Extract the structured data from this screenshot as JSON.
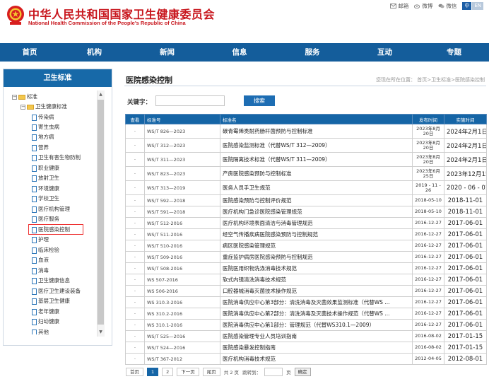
{
  "header": {
    "title": "中华人民共和国国家卫生健康委员会",
    "subtitle": "National Health Commission of the People's Republic of China",
    "links": [
      {
        "icon": "mail-icon",
        "label": "邮箱"
      },
      {
        "icon": "weibo-icon",
        "label": "微博"
      },
      {
        "icon": "wechat-icon",
        "label": "微信"
      }
    ],
    "lang_zh": "中",
    "lang_en": "EN"
  },
  "nav": [
    "首页",
    "机构",
    "新闻",
    "信息",
    "服务",
    "互动",
    "专题"
  ],
  "sidebar": {
    "title": "卫生标准",
    "root": "标准",
    "group": "卫生健康标准",
    "items": [
      "传染病",
      "寄生虫病",
      "地方病",
      "营养",
      "卫生有害生物防制",
      "职业健康",
      "放射卫生",
      "环境健康",
      "学校卫生",
      "医疗机构管理",
      "医疗服务",
      "医院感染控制",
      "护理",
      "临床检验",
      "血液",
      "消毒",
      "卫生健康信息",
      "医疗卫生建设装备",
      "基层卫生健康",
      "老年健康",
      "妇幼健康",
      "其他"
    ]
  },
  "main": {
    "title": "医院感染控制",
    "breadcrumb": "您现在所在位置： 首页>卫生标准>医院感染控制",
    "keyword_label": "关键字：",
    "keyword_value": "",
    "search_label": "搜索",
    "columns": [
      "查看",
      "标准号",
      "标准名",
      "发布时间",
      "实施时间"
    ],
    "rows": [
      {
        "view": "·",
        "std": "WS/T 826—2023",
        "name": "碳青霉烯类耐药肠杆菌预防与控制标准",
        "pub": "2023年8月20日",
        "impl": "2024年2月1日"
      },
      {
        "view": "·",
        "std": "WS/T 312—2023",
        "name": "医院感染监测标准（代替WS/T 312—2009）",
        "pub": "2023年8月20日",
        "impl": "2024年2月1日"
      },
      {
        "view": "·",
        "std": "WS/T 311—2023",
        "name": "医院隔离技术标准（代替WS/T 311—2009）",
        "pub": "2023年8月20日",
        "impl": "2024年2月1日"
      },
      {
        "view": "·",
        "std": "WS/T 823—2023",
        "name": "产房医院感染预防与控制标准",
        "pub": "2023年6月25日",
        "impl": "2023年12月15日"
      },
      {
        "view": "·",
        "std": "WS/T 313—2019",
        "name": "医务人员手卫生规范",
        "pub": "2019 - 11 - 26",
        "impl": "2020 - 06 - 01"
      },
      {
        "view": "·",
        "std": "WS/T 592—2018",
        "name": "医院感染预防与控制评价规范",
        "pub": "2018-05-10",
        "impl": "2018-11-01"
      },
      {
        "view": "·",
        "std": "WS/T 591—2018",
        "name": "医疗机构门急诊医院感染管理规范",
        "pub": "2018-05-10",
        "impl": "2018-11-01"
      },
      {
        "view": "·",
        "std": "WS/T 512-2016",
        "name": "医疗机构环境表面清洁与消毒管理规范",
        "pub": "2016-12-27",
        "impl": "2017-06-01"
      },
      {
        "view": "·",
        "std": "WS/T 511-2016",
        "name": "经空气传播疾病医院感染预防与控制规范",
        "pub": "2016-12-27",
        "impl": "2017-06-01"
      },
      {
        "view": "·",
        "std": "WS/T 510-2016",
        "name": "病区医院感染管理规范",
        "pub": "2016-12-27",
        "impl": "2017-06-01"
      },
      {
        "view": "·",
        "std": "WS/T 509-2016",
        "name": "重症监护病房医院感染预防与控制规范",
        "pub": "2016-12-27",
        "impl": "2017-06-01"
      },
      {
        "view": "·",
        "std": "WS/T 508-2016",
        "name": "医院医用织物洗涤消毒技术规范",
        "pub": "2016-12-27",
        "impl": "2017-06-01"
      },
      {
        "view": "·",
        "std": "WS 507-2016",
        "name": "软式内镜清洗消毒技术规范",
        "pub": "2016-12-27",
        "impl": "2017-06-01"
      },
      {
        "view": "·",
        "std": "WS 506-2016",
        "name": "口腔器械消毒灭菌技术操作规范",
        "pub": "2016-12-27",
        "impl": "2017-06-01"
      },
      {
        "view": "·",
        "std": "WS 310.3-2016",
        "name": "医院消毒供应中心第3部分：清洗消毒及灭菌效果监测标准（代替WS ...",
        "pub": "2016-12-27",
        "impl": "2017-06-01"
      },
      {
        "view": "·",
        "std": "WS 310.2-2016",
        "name": "医院消毒供应中心第2部分：清洗消毒及灭菌技术操作规范（代替WS ...",
        "pub": "2016-12-27",
        "impl": "2017-06-01"
      },
      {
        "view": "·",
        "std": "WS 310.1-2016",
        "name": "医院消毒供应中心第1部分：管理规范（代替WS310.1—2009）",
        "pub": "2016-12-27",
        "impl": "2017-06-01"
      },
      {
        "view": "·",
        "std": "WS/T 525—2016",
        "name": "医院感染管理专业人员培训指南",
        "pub": "2016-08-02",
        "impl": "2017-01-15"
      },
      {
        "view": "·",
        "std": "WS/T 524—2016",
        "name": "医院感染暴发控制指南",
        "pub": "2016-08-02",
        "impl": "2017-01-15"
      },
      {
        "view": "·",
        "std": "WS/T 367-2012",
        "name": "医疗机构消毒技术规范",
        "pub": "2012-04-05",
        "impl": "2012-08-01"
      }
    ]
  },
  "pager": {
    "first": "首页",
    "pages": [
      "1",
      "2"
    ],
    "next": "下一页",
    "last": "尾页",
    "total": "共 2 页",
    "jump_label": "跳转到：",
    "page_unit": "页",
    "go": "确定"
  },
  "colors": {
    "brand_red": "#c8161d",
    "nav_blue": "#145d9b",
    "header_blue": "#1565a6",
    "highlight": "#e33333"
  }
}
